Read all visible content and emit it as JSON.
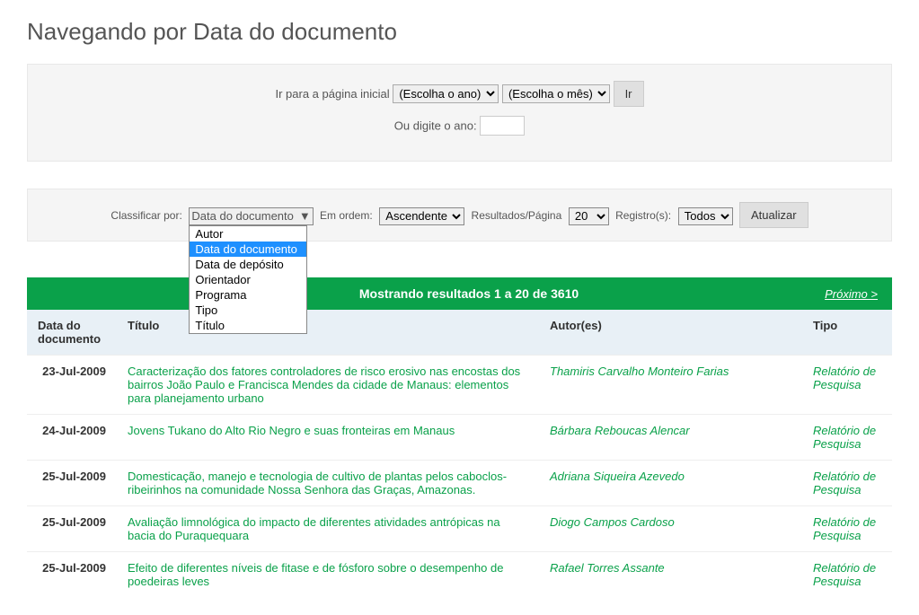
{
  "page_title": "Navegando por Data do documento",
  "jump_panel": {
    "label": "Ir para a página inicial",
    "year_placeholder": "(Escolha o ano)",
    "month_placeholder": "(Escolha o mês)",
    "go_button": "Ir",
    "or_label": "Ou digite o ano:"
  },
  "controls": {
    "sort_label": "Classificar por:",
    "sort_selected": "Data do documento",
    "sort_options": [
      "Autor",
      "Data do documento",
      "Data de depósito",
      "Orientador",
      "Programa",
      "Tipo",
      "Título"
    ],
    "order_label": "Em ordem:",
    "order_selected": "Ascendente",
    "rpp_label": "Resultados/Página",
    "rpp_selected": "20",
    "authors_label": "Registro(s):",
    "authors_selected": "Todos",
    "update_button": "Atualizar"
  },
  "results_header": {
    "text": "Mostrando resultados 1 a 20 de 3610",
    "next": "Próximo >"
  },
  "columns": {
    "date": "Data do documento",
    "title": "Título",
    "author": "Autor(es)",
    "type": "Tipo"
  },
  "rows": [
    {
      "date": "23-Jul-2009",
      "title": "Caracterização dos fatores controladores de risco erosivo nas encostas dos bairros João Paulo e Francisca Mendes da cidade de Manaus: elementos para planejamento urbano",
      "author": "Thamiris Carvalho Monteiro Farias",
      "type": "Relatório de Pesquisa"
    },
    {
      "date": "24-Jul-2009",
      "title": "Jovens Tukano do Alto Rio Negro e suas fronteiras em Manaus",
      "author": "Bárbara Reboucas Alencar",
      "type": "Relatório de Pesquisa"
    },
    {
      "date": "25-Jul-2009",
      "title": "Domesticação, manejo e tecnologia de cultivo de plantas pelos caboclos-ribeirinhos na comunidade Nossa Senhora das Graças, Amazonas.",
      "author": "Adriana Siqueira Azevedo",
      "type": "Relatório de Pesquisa"
    },
    {
      "date": "25-Jul-2009",
      "title": "Avaliação limnológica do impacto de diferentes atividades antrópicas na bacia do Puraquequara",
      "author": "Diogo Campos Cardoso",
      "type": "Relatório de Pesquisa"
    },
    {
      "date": "25-Jul-2009",
      "title": "Efeito de diferentes níveis de fitase e de fósforo sobre o desempenho de poedeiras leves",
      "author": "Rafael Torres Assante",
      "type": "Relatório de Pesquisa"
    }
  ]
}
